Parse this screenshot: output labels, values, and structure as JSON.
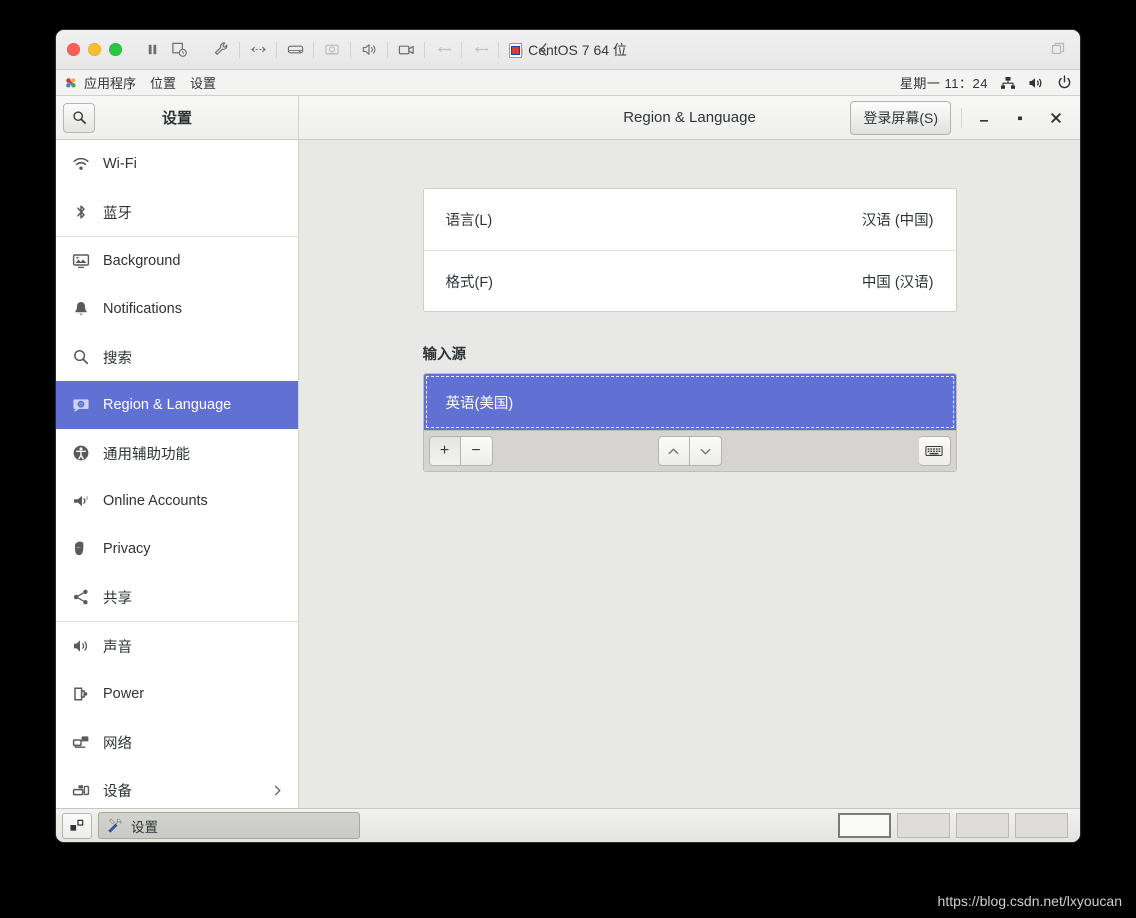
{
  "vm": {
    "title": "CentOS 7 64 位",
    "toolbar_icons": [
      "wrench-icon",
      "network-icon",
      "harddisk-icon",
      "camera-icon",
      "sound-icon",
      "webcam-icon",
      "usb-icon",
      "usb-icon-2",
      "printer-icon",
      "collapse-icon"
    ],
    "pause_icon": "pause-icon",
    "snapshot_icon": "snapshot-icon",
    "window_mode_icon": "windowed-mode-icon"
  },
  "gnome_topbar": {
    "menus": [
      "应用程序",
      "位置",
      "设置"
    ],
    "clock": "星期一  11：24",
    "status_icons": [
      "network-wired-icon",
      "volume-icon",
      "power-icon"
    ]
  },
  "sidebar": {
    "title": "设置",
    "search_icon": "search-icon",
    "items": [
      {
        "label": "Wi-Fi",
        "icon": "wifi-icon",
        "selected": false
      },
      {
        "label": "蓝牙",
        "icon": "bluetooth-icon",
        "selected": false
      },
      {
        "label": "Background",
        "icon": "background-icon",
        "selected": false
      },
      {
        "label": "Notifications",
        "icon": "bell-icon",
        "selected": false
      },
      {
        "label": "搜索",
        "icon": "search-icon",
        "selected": false
      },
      {
        "label": "Region & Language",
        "icon": "region-language-icon",
        "selected": true
      },
      {
        "label": "通用辅助功能",
        "icon": "accessibility-icon",
        "selected": false
      },
      {
        "label": "Online Accounts",
        "icon": "online-accounts-icon",
        "selected": false
      },
      {
        "label": "Privacy",
        "icon": "hand-icon",
        "selected": false
      },
      {
        "label": "共享",
        "icon": "share-icon",
        "selected": false
      },
      {
        "label": "声音",
        "icon": "sound-icon",
        "selected": false
      },
      {
        "label": "Power",
        "icon": "battery-icon",
        "selected": false
      },
      {
        "label": "网络",
        "icon": "network-icon",
        "selected": false
      },
      {
        "label": "设备",
        "icon": "devices-icon",
        "selected": false,
        "chevron": "chevron-right-icon"
      }
    ]
  },
  "content": {
    "title": "Region & Language",
    "login_screen_button": "登录屏幕(S)",
    "window_controls": {
      "minimize": "–",
      "maximize": "▫",
      "close": "✕"
    },
    "rows": [
      {
        "label": "语言(L)",
        "value": "汉语 (中国)"
      },
      {
        "label": "格式(F)",
        "value": "中国 (汉语)"
      }
    ],
    "input_sources": {
      "section_title": "输入源",
      "items": [
        {
          "label": "英语(美国)",
          "selected": true
        }
      ],
      "toolbar": {
        "add": "+",
        "remove": "−",
        "move_up_icon": "chevron-up-icon",
        "move_down_icon": "chevron-down-icon",
        "keyboard_icon": "keyboard-icon"
      }
    }
  },
  "taskbar": {
    "show_desktop_icon": "show-desktop-icon",
    "window_button": {
      "label": "设置",
      "icon": "settings-tools-icon"
    },
    "workspaces": [
      {
        "active": true
      },
      {
        "active": false
      },
      {
        "active": false
      },
      {
        "active": false
      }
    ]
  },
  "watermark": "https://blog.csdn.net/lxyoucan"
}
